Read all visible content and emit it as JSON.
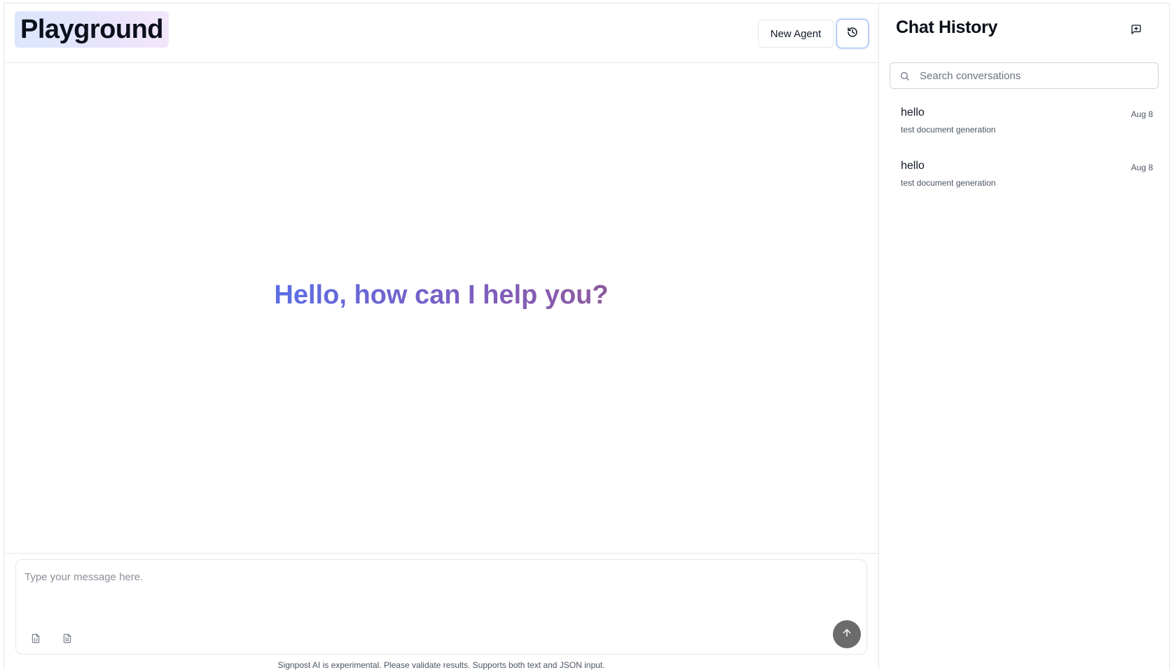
{
  "header": {
    "title": "Playground",
    "new_agent_label": "New Agent",
    "history_icon": "history-icon"
  },
  "main": {
    "greeting": "Hello, how can I help you?",
    "composer": {
      "placeholder": "Type your message here.",
      "tools": [
        "json-file-icon",
        "text-file-icon"
      ],
      "send_icon": "arrow-up-icon"
    },
    "disclaimer": "Signpost AI is experimental. Please validate results. Supports both text and JSON input."
  },
  "sidebar": {
    "title": "Chat History",
    "new_chat_icon": "new-chat-icon",
    "search_placeholder": "Search conversations",
    "conversations": [
      {
        "title": "hello",
        "subtitle": "test document generation",
        "date": "Aug 8"
      },
      {
        "title": "hello",
        "subtitle": "test document generation",
        "date": "Aug 8"
      }
    ]
  },
  "colors": {
    "greeting_gradient_start": "#5b6ee6",
    "greeting_gradient_end": "#8e5a9e",
    "title_badge_bg": "#e3e6fc",
    "history_button_border": "#93b4f5",
    "send_button_bg": "#6b6b6b"
  }
}
